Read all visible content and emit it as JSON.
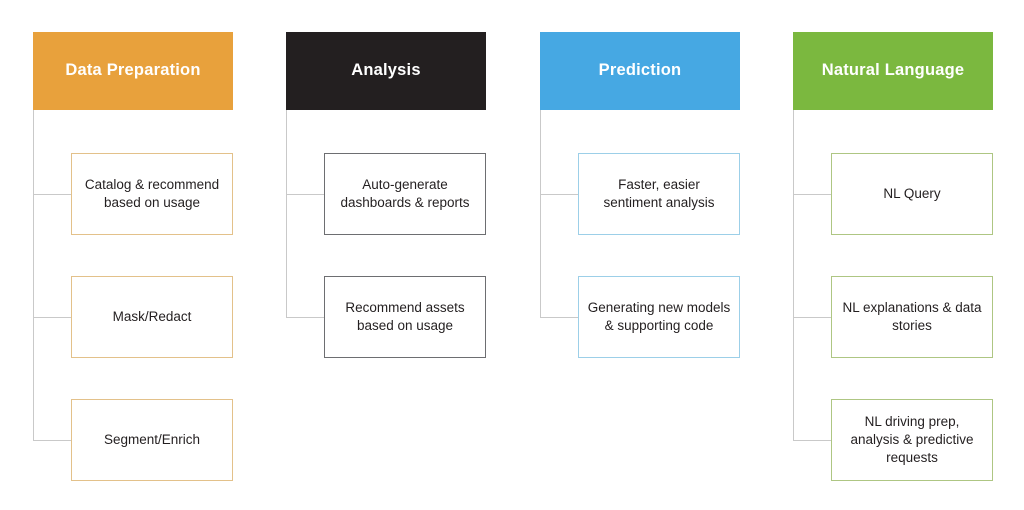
{
  "diagram": {
    "type": "column-tree",
    "background": "#ffffff",
    "line_color": "#c9c9c9",
    "leaf_text_color": "#231f20",
    "header_text_color": "#ffffff",
    "columns": [
      {
        "id": "data-preparation",
        "title": "Data Preparation",
        "header_color": "#e8a13c",
        "leaf_border_color": "#e3c18a",
        "items": [
          {
            "label": "Catalog & recommend based on usage"
          },
          {
            "label": "Mask/Redact"
          },
          {
            "label": "Segment/Enrich"
          }
        ]
      },
      {
        "id": "analysis",
        "title": "Analysis",
        "header_color": "#231f20",
        "leaf_border_color": "#6d6e71",
        "items": [
          {
            "label": "Auto-generate dashboards & reports"
          },
          {
            "label": "Recommend assets based on usage"
          }
        ]
      },
      {
        "id": "prediction",
        "title": "Prediction",
        "header_color": "#46a8e3",
        "leaf_border_color": "#9ccfe8",
        "items": [
          {
            "label": "Faster, easier sentiment analysis"
          },
          {
            "label": "Generating new models & supporting code"
          }
        ]
      },
      {
        "id": "natural-language",
        "title": "Natural Language",
        "header_color": "#7bb83f",
        "leaf_border_color": "#aec683",
        "items": [
          {
            "label": "NL Query"
          },
          {
            "label": "NL explanations & data stories"
          },
          {
            "label": "NL driving prep, analysis & predictive requests"
          }
        ]
      }
    ]
  }
}
